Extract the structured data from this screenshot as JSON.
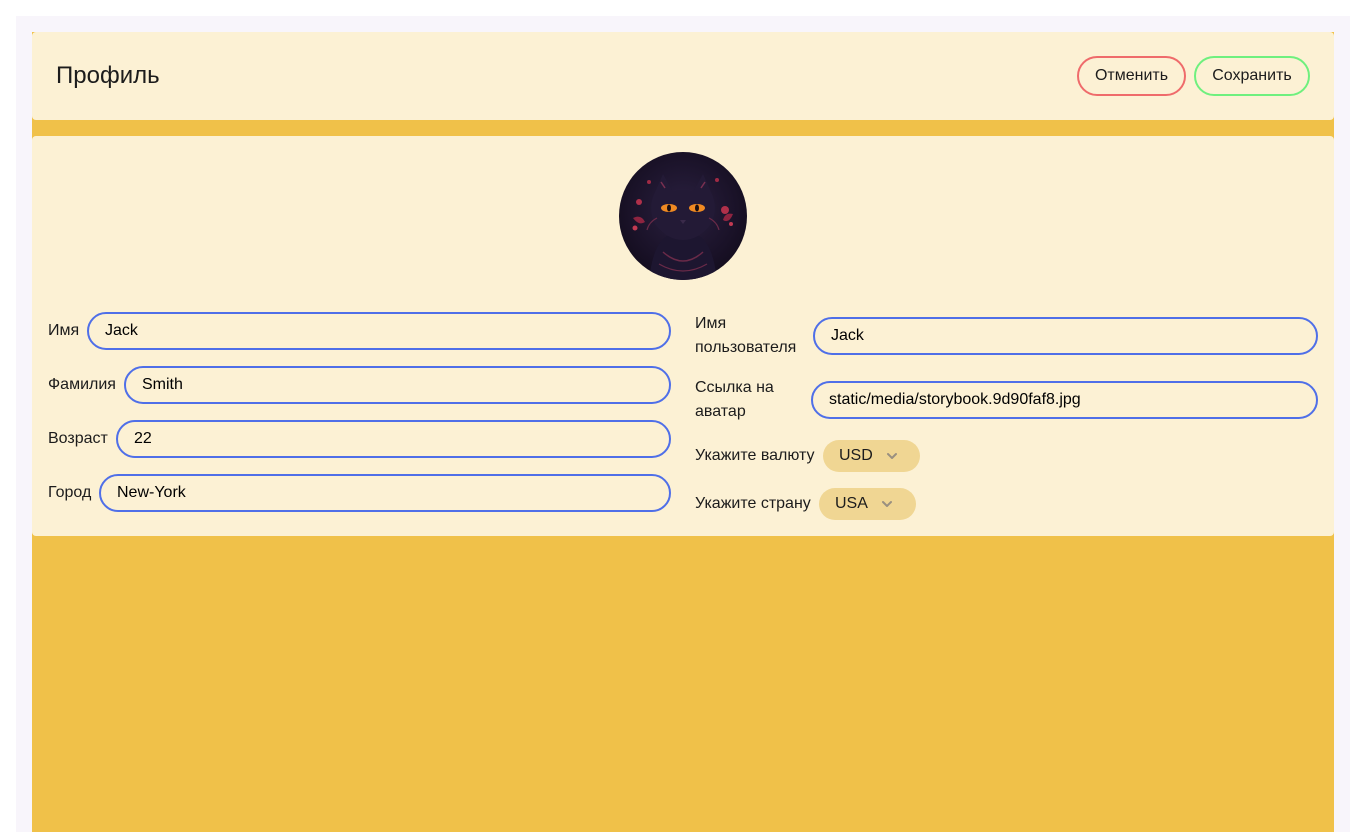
{
  "header": {
    "title": "Профиль",
    "cancel_label": "Отменить",
    "save_label": "Сохранить"
  },
  "avatar": {
    "icon": "black-cat-avatar"
  },
  "form": {
    "first_name": {
      "label": "Имя",
      "value": "Jack"
    },
    "last_name": {
      "label": "Фамилия",
      "value": "Smith"
    },
    "age": {
      "label": "Возраст",
      "value": "22"
    },
    "city": {
      "label": "Город",
      "value": "New-York"
    },
    "username": {
      "label_line1": "Имя",
      "label_line2": "пользователя",
      "value": "Jack"
    },
    "avatar_link": {
      "label_line1": "Ссылка на",
      "label_line2": "аватар",
      "value": "static/media/storybook.9d90faf8.jpg"
    },
    "currency": {
      "label": "Укажите валюту",
      "value": "USD"
    },
    "country": {
      "label": "Укажите страну",
      "value": "USA"
    }
  },
  "colors": {
    "page_bg": "#f8f5fb",
    "accent": "#f0c149",
    "card_bg": "#fcf1d4",
    "input_border": "#4f6fe8",
    "cancel_border": "#ef6b6b",
    "save_border": "#6ff07e",
    "select_bg": "#f0d693"
  }
}
